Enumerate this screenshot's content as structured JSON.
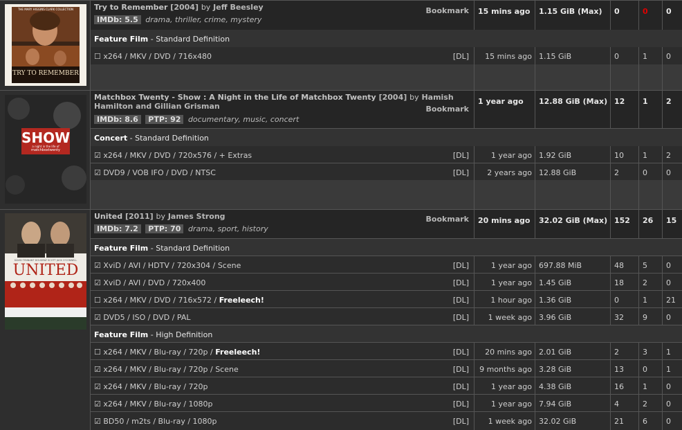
{
  "movies": [
    {
      "title": "Try to Remember",
      "year": "[2004]",
      "by": "by",
      "director": "Jeff Beesley",
      "bookmark": "Bookmark",
      "imdb": "IMDb: 5.5",
      "ptp": "",
      "genres": "drama, thriller, crime, mystery",
      "time": "15 mins ago",
      "size": "1.15 GiB (Max)",
      "snatched": "0",
      "seeders": "0",
      "leechers": "0",
      "poster_top_text": "THE MARY HIGGINS CLARK COLLECTION",
      "poster_title": "TRY TO REMEMBER",
      "groups": [
        {
          "category": "Feature Film",
          "quality": " - Standard Definition",
          "torrents": [
            {
              "checkbox": "☐",
              "format": "x264 / MKV / DVD / 716x480",
              "extra": "",
              "dl": "[DL]",
              "time": "15 mins ago",
              "size": "1.15 GiB",
              "snatched": "0",
              "seeders": "1",
              "leechers": "0"
            }
          ]
        }
      ]
    },
    {
      "title": "Matchbox Twenty - Show : A Night in the Life of Matchbox Twenty",
      "year": "[2004]",
      "by": "by",
      "director": "Hamish Hamilton and Gillian Grisman",
      "bookmark": "Bookmark",
      "imdb": "IMDb: 8.6",
      "ptp": "PTP: 92",
      "genres": "documentary, music, concert",
      "time": "1 year ago",
      "size": "12.88 GiB (Max)",
      "snatched": "12",
      "seeders": "1",
      "leechers": "2",
      "poster_title": "SHOW",
      "poster_sub": "a night in the life of",
      "poster_band": "matchboxtwenty",
      "groups": [
        {
          "category": "Concert",
          "quality": " - Standard Definition",
          "torrents": [
            {
              "checkbox": "☑",
              "format": "x264 / MKV / DVD / 720x576 / + Extras",
              "extra": "",
              "dl": "[DL]",
              "time": "1 year ago",
              "size": "1.92 GiB",
              "snatched": "10",
              "seeders": "1",
              "leechers": "2"
            },
            {
              "checkbox": "☑",
              "format": "DVD9 / VOB IFO / DVD / NTSC",
              "extra": "",
              "dl": "[DL]",
              "time": "2 years ago",
              "size": "12.88 GiB",
              "snatched": "2",
              "seeders": "0",
              "leechers": "0"
            }
          ]
        }
      ]
    },
    {
      "title": "United",
      "year": "[2011]",
      "by": "by",
      "director": "James Strong",
      "bookmark": "Bookmark",
      "imdb": "IMDb: 7.2",
      "ptp": "PTP: 70",
      "genres": "drama, sport, history",
      "time": "20 mins ago",
      "size": "32.02 GiB (Max)",
      "snatched": "152",
      "seeders": "26",
      "leechers": "15",
      "poster_title": "UNITED",
      "poster_names": "DAVID TENNANT   DOUGRAY SCOTT   JACK O'CONNELL",
      "groups": [
        {
          "category": "Feature Film",
          "quality": " - Standard Definition",
          "torrents": [
            {
              "checkbox": "☑",
              "format": "XviD / AVI / HDTV / 720x304 / Scene",
              "extra": "",
              "dl": "[DL]",
              "time": "1 year ago",
              "size": "697.88 MiB",
              "snatched": "48",
              "seeders": "5",
              "leechers": "0"
            },
            {
              "checkbox": "☑",
              "format": "XviD / AVI / DVD / 720x400",
              "extra": "",
              "dl": "[DL]",
              "time": "1 year ago",
              "size": "1.45 GiB",
              "snatched": "18",
              "seeders": "2",
              "leechers": "0"
            },
            {
              "checkbox": "☐",
              "format": "x264 / MKV / DVD / 716x572 / ",
              "extra": "Freeleech!",
              "dl": "[DL]",
              "time": "1 hour ago",
              "size": "1.36 GiB",
              "snatched": "0",
              "seeders": "1",
              "leechers": "21"
            },
            {
              "checkbox": "☑",
              "format": "DVD5 / ISO / DVD / PAL",
              "extra": "",
              "dl": "[DL]",
              "time": "1 week ago",
              "size": "3.96 GiB",
              "snatched": "32",
              "seeders": "9",
              "leechers": "0"
            }
          ]
        },
        {
          "category": "Feature Film",
          "quality": " - High Definition",
          "torrents": [
            {
              "checkbox": "☐",
              "format": "x264 / MKV / Blu-ray / 720p / ",
              "extra": "Freeleech!",
              "dl": "[DL]",
              "time": "20 mins ago",
              "size": "2.01 GiB",
              "snatched": "2",
              "seeders": "3",
              "leechers": "1"
            },
            {
              "checkbox": "☑",
              "format": "x264 / MKV / Blu-ray / 720p / Scene",
              "extra": "",
              "dl": "[DL]",
              "time": "9 months ago",
              "size": "3.28 GiB",
              "snatched": "13",
              "seeders": "0",
              "leechers": "1"
            },
            {
              "checkbox": "☑",
              "format": "x264 / MKV / Blu-ray / 720p",
              "extra": "",
              "dl": "[DL]",
              "time": "1 year ago",
              "size": "4.38 GiB",
              "snatched": "16",
              "seeders": "1",
              "leechers": "0"
            },
            {
              "checkbox": "☑",
              "format": "x264 / MKV / Blu-ray / 1080p",
              "extra": "",
              "dl": "[DL]",
              "time": "1 year ago",
              "size": "7.94 GiB",
              "snatched": "4",
              "seeders": "2",
              "leechers": "0"
            },
            {
              "checkbox": "☑",
              "format": "BD50 / m2ts / Blu-ray / 1080p",
              "extra": "",
              "dl": "[DL]",
              "time": "1 week ago",
              "size": "32.02 GiB",
              "snatched": "21",
              "seeders": "6",
              "leechers": "0"
            }
          ]
        }
      ]
    }
  ],
  "colors": {
    "zero_seeders": "#e00000",
    "background": "#1a1a1a",
    "row": "#2c2c2c",
    "header": "#252525"
  }
}
